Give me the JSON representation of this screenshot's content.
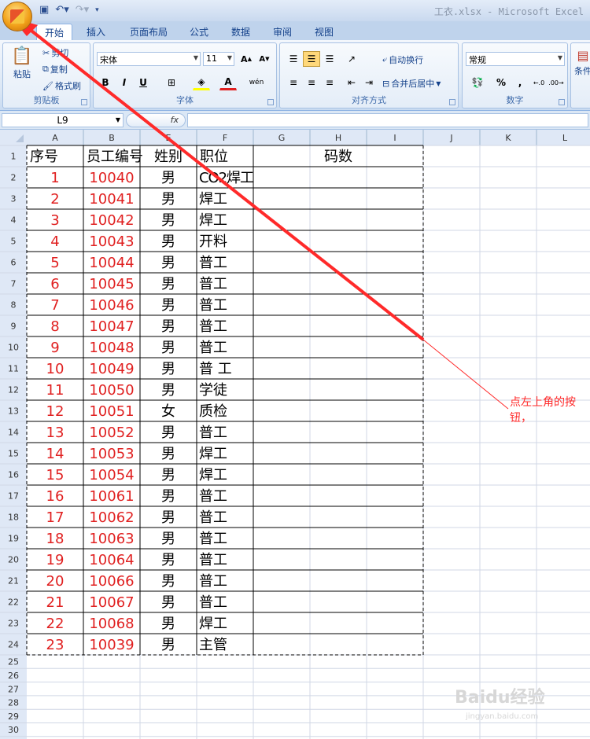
{
  "window": {
    "title": "工衣.xlsx - Microsoft Excel"
  },
  "tabs": [
    "开始",
    "插入",
    "页面布局",
    "公式",
    "数据",
    "审阅",
    "视图"
  ],
  "ribbon": {
    "clipboard": {
      "label": "剪贴板",
      "paste": "粘贴",
      "cut": "剪切",
      "copy": "复制",
      "format_painter": "格式刷"
    },
    "font": {
      "label": "字体",
      "name": "宋体",
      "size": "11",
      "bold": "B",
      "italic": "I",
      "underline": "U"
    },
    "alignment": {
      "label": "对齐方式",
      "wrap": "自动换行",
      "merge": "合并后居中"
    },
    "number": {
      "label": "数字",
      "format": "常规",
      "percent": "%",
      "comma": ","
    },
    "styles": {
      "label": "条件"
    }
  },
  "formula_bar": {
    "name_box": "L9",
    "fx": "fx",
    "value": ""
  },
  "sheet": {
    "columns": [
      "A",
      "B",
      "E",
      "F",
      "G",
      "H",
      "I",
      "J",
      "K",
      "L"
    ],
    "header": [
      "序号",
      "员工编号",
      "姓别",
      "职位",
      "码数"
    ],
    "rows": [
      [
        "1",
        "10040",
        "男",
        "CO2焊工"
      ],
      [
        "2",
        "10041",
        "男",
        "焊工"
      ],
      [
        "3",
        "10042",
        "男",
        "焊工"
      ],
      [
        "4",
        "10043",
        "男",
        "开料"
      ],
      [
        "5",
        "10044",
        "男",
        "普工"
      ],
      [
        "6",
        "10045",
        "男",
        "普工"
      ],
      [
        "7",
        "10046",
        "男",
        "普工"
      ],
      [
        "8",
        "10047",
        "男",
        "普工"
      ],
      [
        "9",
        "10048",
        "男",
        "普工"
      ],
      [
        "10",
        "10049",
        "男",
        "普 工"
      ],
      [
        "11",
        "10050",
        "男",
        "学徒"
      ],
      [
        "12",
        "10051",
        "女",
        "质检"
      ],
      [
        "13",
        "10052",
        "男",
        "普工"
      ],
      [
        "14",
        "10053",
        "男",
        "焊工"
      ],
      [
        "15",
        "10054",
        "男",
        "焊工"
      ],
      [
        "16",
        "10061",
        "男",
        "普工"
      ],
      [
        "17",
        "10062",
        "男",
        "普工"
      ],
      [
        "18",
        "10063",
        "男",
        "普工"
      ],
      [
        "19",
        "10064",
        "男",
        "普工"
      ],
      [
        "20",
        "10066",
        "男",
        "普工"
      ],
      [
        "21",
        "10067",
        "男",
        "普工"
      ],
      [
        "22",
        "10068",
        "男",
        "焊工"
      ],
      [
        "23",
        "10039",
        "男",
        "主管"
      ]
    ],
    "row_numbers_total": 30
  },
  "annotation": {
    "text": "点左上角的按钮，",
    "color": "#ff2a2a"
  },
  "watermark": {
    "brand": "Baidu经验",
    "url": "jingyan.baidu.com"
  },
  "colors": {
    "accent_red": "#e02020",
    "grid_line": "#d0d7e5",
    "header_bg": "#dfe8f6"
  }
}
